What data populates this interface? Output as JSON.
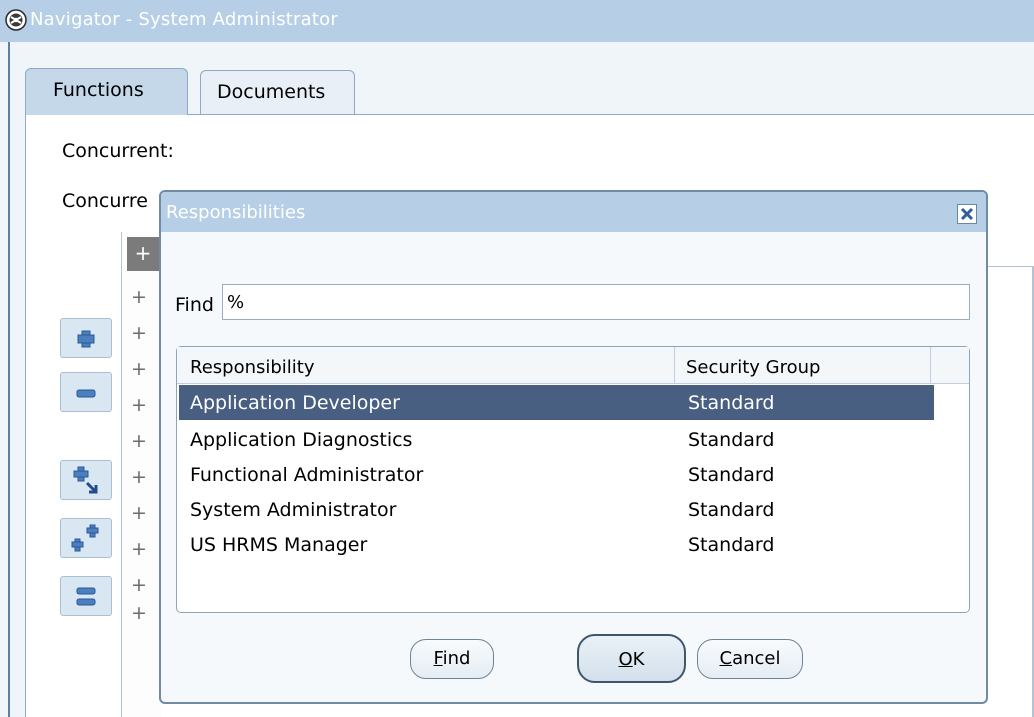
{
  "window": {
    "title": "Navigator - System Administrator",
    "icon": "oracle-navigator-icon"
  },
  "tabs": [
    {
      "label": "Functions",
      "active": true
    },
    {
      "label": "Documents",
      "active": false
    }
  ],
  "main": {
    "label_concurrent": "Concurrent:",
    "label_concurrent2": "Concurre",
    "tree_selected_glyph": "+",
    "tree_plus_glyph": "+",
    "toolbar_icons": [
      "expand-icon",
      "collapse-icon",
      "expand-branch-icon",
      "expand-all-icon",
      "collapse-all-icon"
    ]
  },
  "dialog": {
    "title": "Responsibilities",
    "close_icon": "close-icon",
    "find_label": "Find",
    "find_value": "%",
    "columns": [
      "Responsibility",
      "Security Group"
    ],
    "rows": [
      {
        "responsibility": "Application Developer",
        "security_group": "Standard",
        "selected": true
      },
      {
        "responsibility": "Application Diagnostics",
        "security_group": "Standard",
        "selected": false
      },
      {
        "responsibility": "Functional Administrator",
        "security_group": "Standard",
        "selected": false
      },
      {
        "responsibility": "System Administrator",
        "security_group": "Standard",
        "selected": false
      },
      {
        "responsibility": "US HRMS Manager",
        "security_group": "Standard",
        "selected": false
      }
    ],
    "buttons": {
      "find_mnemonic": "F",
      "find_rest": "ind",
      "ok_mnemonic": "O",
      "ok_rest": "K",
      "cancel_mnemonic": "C",
      "cancel_rest": "ancel"
    }
  },
  "colors": {
    "titlebar": "#b6cfe6",
    "selection": "#485f82",
    "active_tab": "#c4d8ea"
  }
}
